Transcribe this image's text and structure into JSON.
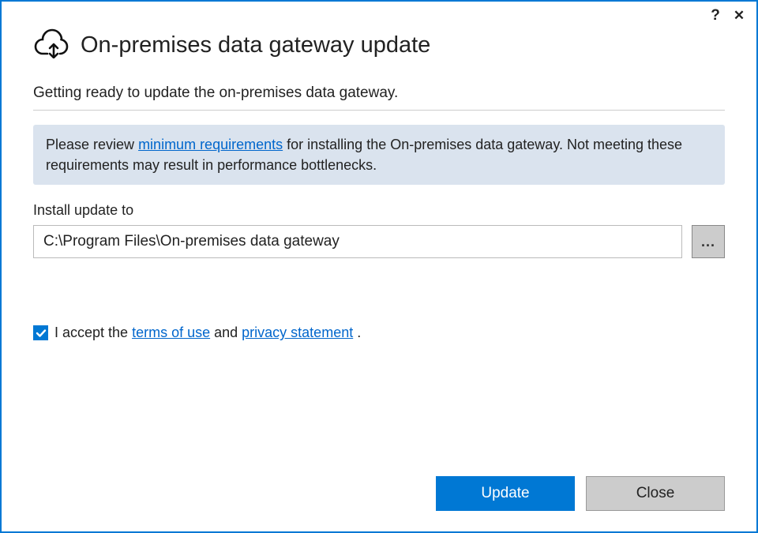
{
  "titlebar": {
    "help_icon": "?",
    "close_icon": "✕"
  },
  "header": {
    "title": "On-premises data gateway update"
  },
  "subhead": "Getting ready to update the on-premises data gateway.",
  "info": {
    "pre": "Please review ",
    "link": "minimum requirements",
    "post": " for installing the On-premises data gateway. Not meeting these requirements may result in performance bottlenecks."
  },
  "install": {
    "label": "Install update to",
    "path": "C:\\Program Files\\On-premises data gateway",
    "browse": "..."
  },
  "accept": {
    "checked": true,
    "pre": "I accept the ",
    "terms": "terms of use",
    "mid": " and ",
    "privacy": "privacy statement",
    "post": " ."
  },
  "footer": {
    "update": "Update",
    "close": "Close"
  }
}
